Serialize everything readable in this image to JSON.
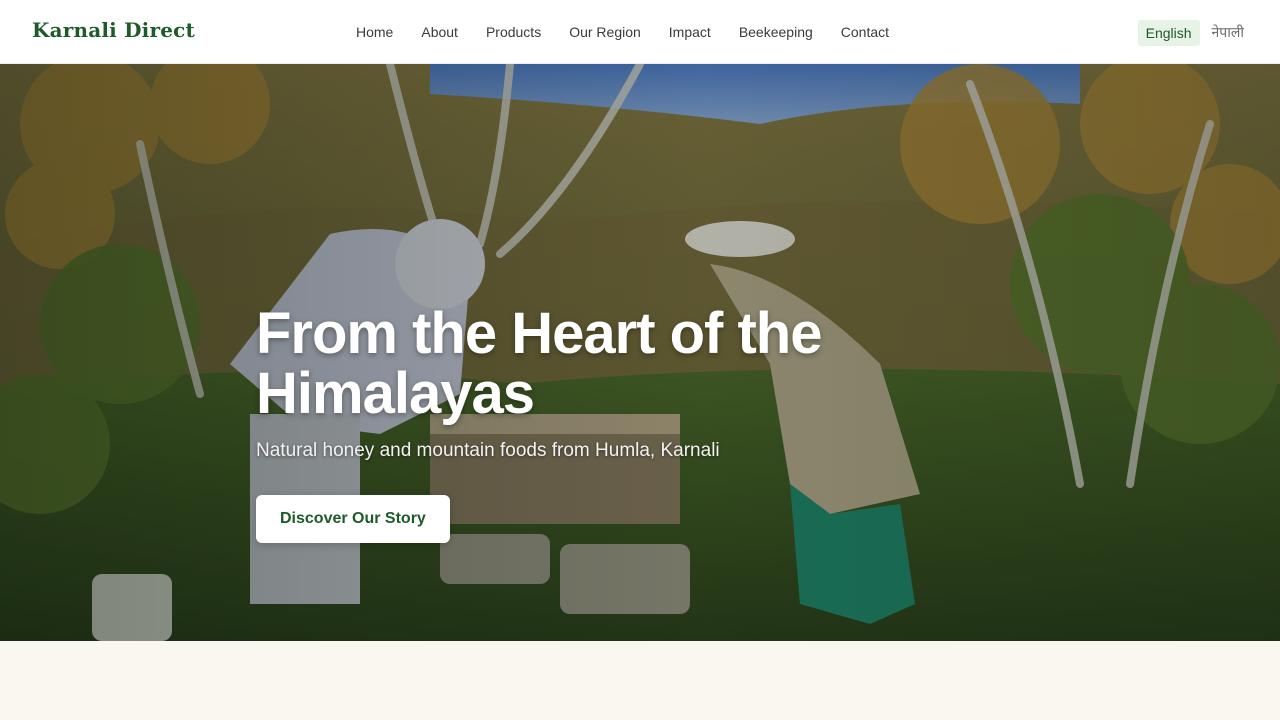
{
  "header": {
    "brand": "Karnali Direct",
    "nav": [
      {
        "label": "Home"
      },
      {
        "label": "About"
      },
      {
        "label": "Products"
      },
      {
        "label": "Our Region"
      },
      {
        "label": "Impact"
      },
      {
        "label": "Beekeeping"
      },
      {
        "label": "Contact"
      }
    ],
    "language": {
      "active": "English",
      "other": "नेपाली"
    }
  },
  "hero": {
    "title": "From the Heart of the Himalayas",
    "subtitle": "Natural honey and mountain foods from Humla, Karnali",
    "cta_label": "Discover Our Story"
  },
  "colors": {
    "brand": "#1f5a2a",
    "lang_active_bg": "#e7f3e6",
    "page_bg": "#faf6f0"
  }
}
